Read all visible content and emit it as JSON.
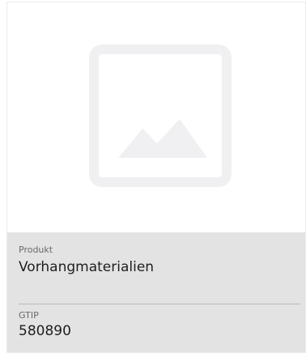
{
  "product": {
    "label": "Produkt",
    "value": "Vorhangmaterialien"
  },
  "gtip": {
    "label": "GTIP",
    "value": "580890"
  },
  "image": {
    "icon": "image-placeholder-icon"
  },
  "colors": {
    "info_background": "#e3e3e3",
    "placeholder_icon": "#f0f0f3"
  }
}
